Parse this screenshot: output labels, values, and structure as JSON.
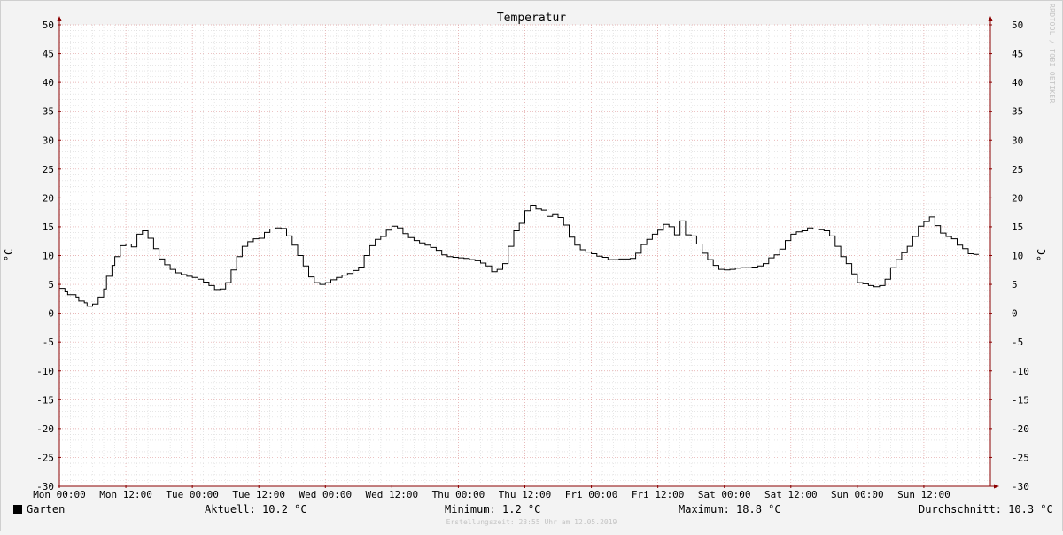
{
  "chart_data": {
    "type": "line",
    "title": "Temperatur",
    "ylabel": "°C",
    "ylim": [
      -30,
      50
    ],
    "y_ticks": [
      "50",
      "45",
      "40",
      "35",
      "30",
      "25",
      "20",
      "15",
      "10",
      "5",
      "0",
      "-5",
      "-10",
      "-15",
      "-20",
      "-25",
      "-30"
    ],
    "x_ticks": [
      "Mon 00:00",
      "Mon 12:00",
      "Tue 00:00",
      "Tue 12:00",
      "Wed 00:00",
      "Wed 12:00",
      "Thu 00:00",
      "Thu 12:00",
      "Fri 00:00",
      "Fri 12:00",
      "Sat 00:00",
      "Sat 12:00",
      "Sun 00:00",
      "Sun 12:00"
    ],
    "x_unit": "hours since Mon 00:00",
    "xlim": [
      0,
      168
    ],
    "grid": true,
    "series": [
      {
        "name": "Garten",
        "color": "#000000",
        "points": [
          [
            0,
            4.3
          ],
          [
            1,
            3.7
          ],
          [
            1.5,
            3.2
          ],
          [
            3,
            2.8
          ],
          [
            3.5,
            2.1
          ],
          [
            4.5,
            1.8
          ],
          [
            5,
            1.2
          ],
          [
            6,
            1.6
          ],
          [
            7,
            2.8
          ],
          [
            8,
            4.2
          ],
          [
            8.5,
            6.4
          ],
          [
            9.5,
            8.3
          ],
          [
            10,
            9.8
          ],
          [
            11,
            11.7
          ],
          [
            12,
            12
          ],
          [
            13,
            11.5
          ],
          [
            14,
            13.7
          ],
          [
            15,
            14.3
          ],
          [
            16,
            13
          ],
          [
            17,
            11.2
          ],
          [
            18,
            9.4
          ],
          [
            19,
            8.4
          ],
          [
            20,
            7.6
          ],
          [
            21,
            7
          ],
          [
            22,
            6.7
          ],
          [
            23,
            6.4
          ],
          [
            24,
            6.2
          ],
          [
            25,
            5.9
          ],
          [
            26,
            5.4
          ],
          [
            27,
            4.8
          ],
          [
            28,
            4.1
          ],
          [
            29,
            4.2
          ],
          [
            30,
            5.3
          ],
          [
            31,
            7.5
          ],
          [
            32,
            9.8
          ],
          [
            33,
            11.6
          ],
          [
            34,
            12.4
          ],
          [
            35,
            12.9
          ],
          [
            36,
            13
          ],
          [
            37,
            14
          ],
          [
            38,
            14.6
          ],
          [
            39,
            14.8
          ],
          [
            40,
            14.7
          ],
          [
            41,
            13.4
          ],
          [
            42,
            11.8
          ],
          [
            43,
            10
          ],
          [
            44,
            8.2
          ],
          [
            45,
            6.3
          ],
          [
            46,
            5.3
          ],
          [
            47,
            5
          ],
          [
            48,
            5.3
          ],
          [
            49,
            5.8
          ],
          [
            50,
            6.2
          ],
          [
            51,
            6.6
          ],
          [
            52,
            6.9
          ],
          [
            53,
            7.4
          ],
          [
            54,
            8
          ],
          [
            55,
            10
          ],
          [
            56,
            11.7
          ],
          [
            57,
            12.8
          ],
          [
            58,
            13.3
          ],
          [
            59,
            14.4
          ],
          [
            60,
            15.1
          ],
          [
            61,
            14.8
          ],
          [
            62,
            13.8
          ],
          [
            63,
            13.1
          ],
          [
            64,
            12.6
          ],
          [
            65,
            12.2
          ],
          [
            66,
            11.8
          ],
          [
            67,
            11.4
          ],
          [
            68,
            10.9
          ],
          [
            69,
            10.1
          ],
          [
            70,
            9.8
          ],
          [
            71,
            9.7
          ],
          [
            72,
            9.6
          ],
          [
            73,
            9.5
          ],
          [
            74,
            9.3
          ],
          [
            75,
            9.1
          ],
          [
            76,
            8.7
          ],
          [
            77,
            8.2
          ],
          [
            78,
            7.2
          ],
          [
            79,
            7.6
          ],
          [
            80,
            8.6
          ],
          [
            81,
            11.6
          ],
          [
            82,
            14.3
          ],
          [
            83,
            15.6
          ],
          [
            84,
            17.8
          ],
          [
            85,
            18.6
          ],
          [
            86,
            18.1
          ],
          [
            87,
            17.9
          ],
          [
            88,
            16.8
          ],
          [
            89,
            17.1
          ],
          [
            90,
            16.6
          ],
          [
            91,
            15.3
          ],
          [
            92,
            13.2
          ],
          [
            93,
            11.8
          ],
          [
            94,
            11
          ],
          [
            95,
            10.6
          ],
          [
            96,
            10.3
          ],
          [
            97,
            9.9
          ],
          [
            98,
            9.7
          ],
          [
            99,
            9.3
          ],
          [
            100,
            9.3
          ],
          [
            101,
            9.4
          ],
          [
            102,
            9.4
          ],
          [
            103,
            9.5
          ],
          [
            104,
            10.4
          ],
          [
            105,
            11.9
          ],
          [
            106,
            12.8
          ],
          [
            107,
            13.7
          ],
          [
            108,
            14.4
          ],
          [
            109,
            15.4
          ],
          [
            110,
            15
          ],
          [
            111,
            13.6
          ],
          [
            112,
            16
          ],
          [
            113,
            13.6
          ],
          [
            114,
            13.4
          ],
          [
            115,
            12
          ],
          [
            116,
            10.4
          ],
          [
            117,
            9.3
          ],
          [
            118,
            8.3
          ],
          [
            119,
            7.6
          ],
          [
            120,
            7.5
          ],
          [
            121,
            7.6
          ],
          [
            122,
            7.8
          ],
          [
            123,
            7.9
          ],
          [
            124,
            7.9
          ],
          [
            125,
            8
          ],
          [
            126,
            8.2
          ],
          [
            127,
            8.6
          ],
          [
            128,
            9.6
          ],
          [
            129,
            10.1
          ],
          [
            130,
            11.1
          ],
          [
            131,
            12.6
          ],
          [
            132,
            13.7
          ],
          [
            133,
            14.1
          ],
          [
            134,
            14.3
          ],
          [
            135,
            14.8
          ],
          [
            136,
            14.6
          ],
          [
            137,
            14.5
          ],
          [
            138,
            14.3
          ],
          [
            139,
            13.4
          ],
          [
            140,
            11.6
          ],
          [
            141,
            9.8
          ],
          [
            142,
            8.6
          ],
          [
            143,
            6.8
          ],
          [
            144,
            5.3
          ],
          [
            145,
            5.1
          ],
          [
            146,
            4.8
          ],
          [
            147,
            4.6
          ],
          [
            148,
            4.8
          ],
          [
            149,
            5.9
          ],
          [
            150,
            7.9
          ],
          [
            151,
            9.3
          ],
          [
            152,
            10.5
          ],
          [
            153,
            11.6
          ],
          [
            154,
            13.3
          ],
          [
            155,
            15.1
          ],
          [
            156,
            15.9
          ],
          [
            157,
            16.7
          ],
          [
            158,
            15.2
          ],
          [
            159,
            13.9
          ],
          [
            160,
            13.3
          ],
          [
            161,
            12.9
          ],
          [
            162,
            11.8
          ],
          [
            163,
            11.2
          ],
          [
            164,
            10.3
          ],
          [
            165,
            10.2
          ]
        ]
      }
    ]
  },
  "legend": {
    "series_name": "Garten",
    "aktuell": "Aktuell: 10.2 °C",
    "minimum": "Minimum: 1.2 °C",
    "maximum": "Maximum: 18.8 °C",
    "durchschnitt": "Durchschnitt: 10.3 °C"
  },
  "watermark": "RRDTOOL / TOBI OETIKER",
  "footer": "Erstellungszeit: 23:55 Uhr am 12.05.2019",
  "colors": {
    "background": "#f3f3f3",
    "plot_background": "#ffffff",
    "major_grid": "#e0a0a0",
    "minor_grid": "#d8d8d8",
    "axis": "#8b0000",
    "line": "#000000"
  }
}
